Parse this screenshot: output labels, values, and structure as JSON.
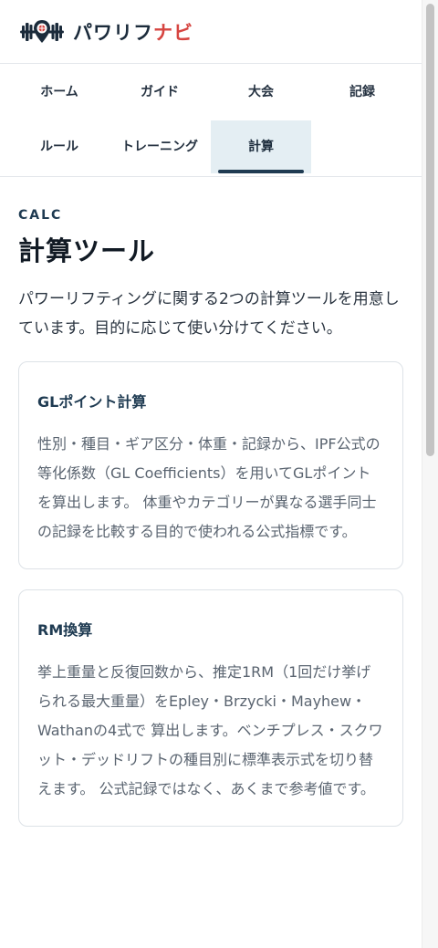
{
  "header": {
    "logo_icon": "barbell-pin-icon",
    "brand_part1": "パワリフ",
    "brand_part2": "ナビ"
  },
  "nav": {
    "items": [
      {
        "label": "ホーム",
        "active": false
      },
      {
        "label": "ガイド",
        "active": false
      },
      {
        "label": "大会",
        "active": false
      },
      {
        "label": "記録",
        "active": false
      },
      {
        "label": "ルール",
        "active": false
      },
      {
        "label": "トレーニング",
        "active": false
      },
      {
        "label": "計算",
        "active": true
      }
    ]
  },
  "main": {
    "eyebrow": "CALC",
    "title": "計算ツール",
    "intro": "パワーリフティングに関する2つの計算ツールを用意しています。目的に応じて使い分けてください。",
    "cards": [
      {
        "title": "GLポイント計算",
        "body": "性別・種目・ギア区分・体重・記録から、IPF公式の等化係数（GL Coefficients）を用いてGLポイントを算出します。 体重やカテゴリーが異なる選手同士の記録を比較する目的で使われる公式指標です。"
      },
      {
        "title": "RM換算",
        "body": "挙上重量と反復回数から、推定1RM（1回だけ挙げられる最大重量）をEpley・Brzycki・Mayhew・Wathanの4式で 算出します。ベンチプレス・スクワット・デッドリフトの種目別に標準表示式を切り替えます。 公式記録ではなく、あくまで参考値です。"
      }
    ]
  },
  "colors": {
    "brand_dark": "#1b2b3b",
    "brand_accent": "#d64541",
    "active_tab_bg": "#e4eef3",
    "card_title": "#1f3b52"
  }
}
